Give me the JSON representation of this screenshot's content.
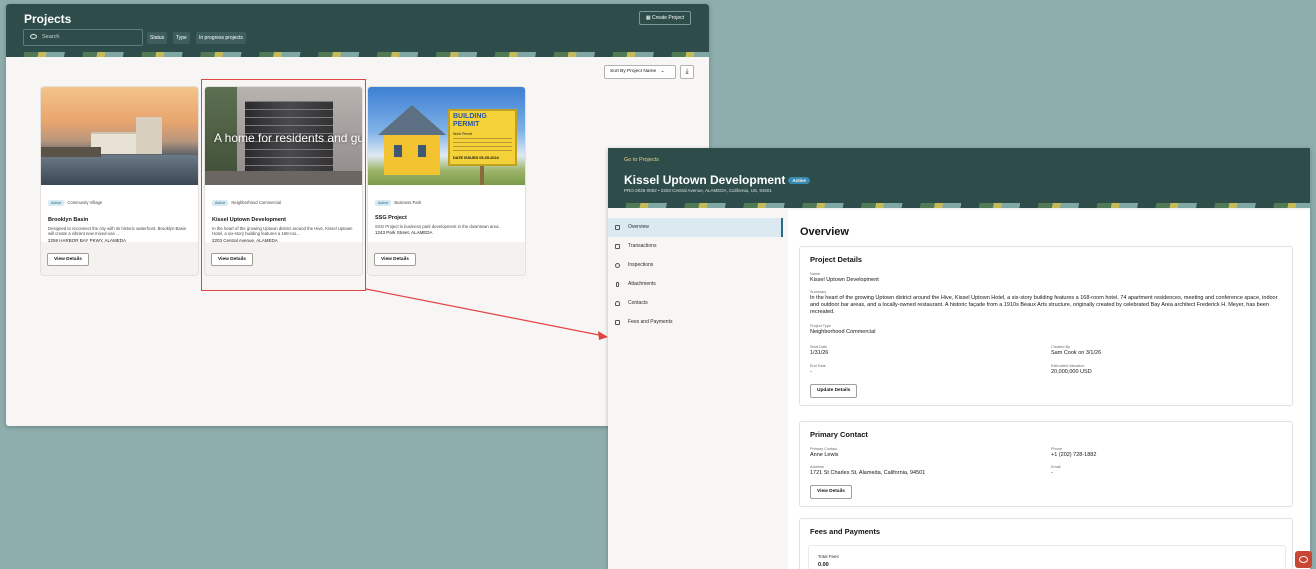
{
  "projects_page": {
    "title": "Projects",
    "create_button": "Create Project",
    "search_placeholder": "Search",
    "filters": [
      "Status",
      "Type",
      "In progress projects"
    ],
    "sort_label": "Sort By Project Name",
    "sort_chevron": "⌄",
    "download_glyph": "⤓",
    "cards": [
      {
        "badge": "Active",
        "category": "Community Village",
        "name": "Brooklyn Basin",
        "description": "Designed to reconnect the city with its historic waterfront, Brooklyn Basin will create a vibrant new mixed-use ...",
        "address": "2259 HARBOR BAY PKWY, ALAMEDA",
        "button": "View Details"
      },
      {
        "badge": "Active",
        "category": "Neighborhood Commercial",
        "name": "Kissel Uptown Development",
        "description": "In the heart of the growing Uptown district around the Hive, Kissel Uptown Hotel, a six-story building features a 168-roo...",
        "address": "2203 Central Avenue, ALAMEDA",
        "button": "View Details",
        "image_caption": "A home for residents and gue"
      },
      {
        "badge": "Active",
        "category": "Business Park",
        "name": "SSG Project",
        "description": "SSG Project is business park development in the downtown area.",
        "address": "1243 Park Street, ALAMEDA",
        "button": "View Details",
        "sign_title": "BUILDING PERMIT",
        "sign_sub": "Work Permit",
        "sign_issued": "DATE ISSUED 05-05-2024"
      }
    ]
  },
  "detail_page": {
    "back_link": "Go to Projects",
    "title": "Kissel Uptown Development",
    "status_badge": "Active",
    "subtitle": "PRO-2026-0002 • 2203 Central Avenue, ALAMEDA, California, US, 94501",
    "nav": [
      "Overview",
      "Transactions",
      "Inspections",
      "Attachments",
      "Contacts",
      "Fees and Payments"
    ],
    "overview_heading": "Overview",
    "project_details": {
      "heading": "Project Details",
      "name_label": "Name",
      "name": "Kissel Uptown Development",
      "summary_label": "Summary",
      "summary": "In the heart of the growing Uptown district around the Hive, Kissel Uptown Hotel, a six-story building features a 168-room hotel, 74 apartment residences, meeting and conference space, indoor and outdoor bar areas, and a locally-owned restaurant. A historic façade from a 1910s Beaux Arts structure, originally created by celebrated Bay Area architect Frederick H. Meyer, has been recreated.",
      "type_label": "Project Type",
      "type": "Neighborhood Commercial",
      "start_label": "Start Date",
      "start": "1/31/26",
      "created_label": "Created By",
      "created": "Sam Cook on 3/1/26",
      "end_label": "End Date",
      "end": "-",
      "valuation_label": "Estimated Valuation",
      "valuation": "20,000,000 USD",
      "button": "Update Details"
    },
    "primary_contact": {
      "heading": "Primary Contact",
      "contact_label": "Primary Contact",
      "contact": "Anne Lewis",
      "phone_label": "Phone",
      "phone": "+1 (202) 728-1882",
      "address_label": "Address",
      "address": "1721 St Charles St, Alameda, California, 94501",
      "email_label": "Email",
      "email": "-",
      "button": "View Details"
    },
    "fees": {
      "heading": "Fees and Payments",
      "total_label": "Total Fees",
      "total": "0.00"
    }
  },
  "colors": {
    "header": "#2d4c4a",
    "accent_red": "#e04545",
    "badge": "#3a8bb1"
  }
}
